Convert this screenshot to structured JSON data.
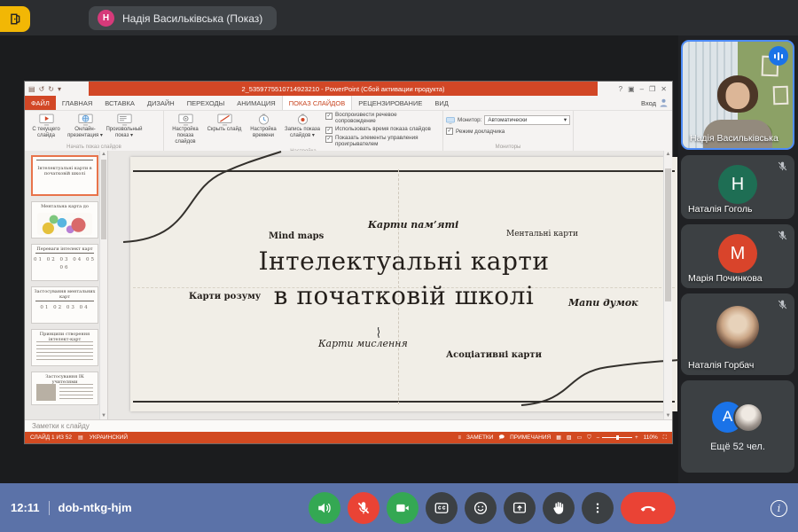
{
  "meet": {
    "topbar": {
      "presenter_pill": "Надія Васильківська (Показ)",
      "presenter_initial": "Н"
    },
    "sidebar": {
      "self": {
        "name": "Надія Васильківська"
      },
      "participants": [
        {
          "name": "Наталія Гоголь",
          "initial": "Н",
          "avatar_color": "#1e6e54"
        },
        {
          "name": "Марія Починкова",
          "initial": "М",
          "avatar_color": "#d9442b"
        },
        {
          "name": "Наталія Горбач"
        },
        {
          "label": "Ещё 52 чел.",
          "initial": "A",
          "avatar_color": "#1a73e8"
        }
      ]
    },
    "bottombar": {
      "time": "12:11",
      "code": "dob-ntkg-hjm"
    },
    "colors": {
      "accent_blue": "#1a73e8",
      "active_border": "#4e8cf7",
      "green": "#34a853",
      "red": "#ea4335",
      "bar": "#5b72a8"
    }
  },
  "ppt": {
    "title": "2_5359775510714923210 - PowerPoint (Сбой активации продукта)",
    "signin": "Вход",
    "qat": {
      "save": "▤",
      "undo": "↺",
      "redo": "↻",
      "dropdown": "▾"
    },
    "window_controls": {
      "help": "?",
      "ribbon_display": "▣",
      "minimize": "–",
      "restore": "❐",
      "close": "✕"
    },
    "tabs": [
      "ФАЙЛ",
      "ГЛАВНАЯ",
      "ВСТАВКА",
      "ДИЗАЙН",
      "ПЕРЕХОДЫ",
      "АНИМАЦИЯ",
      "ПОКАЗ СЛАЙДОВ",
      "РЕЦЕНЗИРОВАНИЕ",
      "ВИД"
    ],
    "ribbon": {
      "btn_current": "С текущего слайда",
      "btn_online": "Онлайн-презентация ▾",
      "btn_custom": "Произвольный показ ▾",
      "btn_setup": "Настройка показа слайдов",
      "btn_hide": "Скрыть слайд",
      "btn_rehearse": "Настройка времени",
      "btn_record": "Запись показа слайдов ▾",
      "chk1": "Воспроизвести речевое сопровождение",
      "chk2": "Использовать время показа слайдов",
      "chk3": "Показать элементы управления проигрывателем",
      "monitor_label": "Монитор:",
      "monitor_value": "Автоматически",
      "chk_presenter": "Режим докладчика",
      "grp_start": "Начать показ слайдов",
      "grp_setup": "Настройка",
      "grp_monitors": "Мониторы",
      "check_glyph": "✓"
    },
    "thumbnails": [
      {
        "title": "Інтелектуальні карти в початковій школі",
        "detail": ""
      },
      {
        "title": "Ментальна карта до",
        "detail": ""
      },
      {
        "title": "Переваги інтелект карт",
        "detail": "01 02 03 04 05 06"
      },
      {
        "title": "Застосування ментальних карт",
        "detail": "01 02 03 04"
      },
      {
        "title": "Принципи створення інтелект-карт",
        "detail": ""
      },
      {
        "title": "Застосування ІК учителями",
        "detail": ""
      }
    ],
    "slide": {
      "title_line1": "Інтелектуальні карти",
      "title_line2": "в початковій школі",
      "label_mind_maps": "Mind maps",
      "label_memory": "Карти пам’яті",
      "label_mental": "Ментальні карти",
      "label_mind": "Карти розуму",
      "label_thought": "Мапи думок",
      "label_thinking": "Карти мислення",
      "label_assoc": "Асоціативні карти"
    },
    "notes_placeholder": "Заметки к слайду",
    "status": {
      "slide_counter": "СЛАЙД 1 ИЗ 52",
      "language": "УКРАИНСКИЙ",
      "notes": "ЗАМЕТКИ",
      "comments": "ПРИМЕЧАНИЯ",
      "zoom": "110%"
    }
  }
}
